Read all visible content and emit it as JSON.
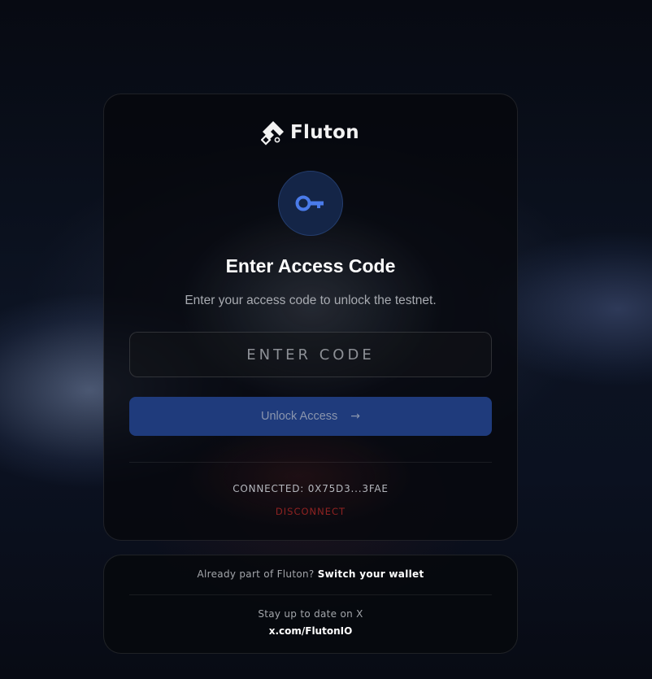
{
  "brand": {
    "name": "Fluton",
    "logo_icon": "fluton-logo-icon"
  },
  "access": {
    "icon": "key-icon",
    "title": "Enter Access Code",
    "subtitle": "Enter your access code to unlock the testnet.",
    "code_placeholder": "ENTER CODE",
    "code_value": "",
    "unlock_label": "Unlock Access",
    "unlock_icon": "arrow-right-icon"
  },
  "wallet": {
    "connected_text": "CONNECTED: 0X75D3...3FAE",
    "disconnect_label": "DISCONNECT"
  },
  "footer": {
    "already_text": "Already part of Fluton?",
    "switch_label": "Switch your wallet",
    "stay_text": "Stay up to date on X",
    "x_link": "x.com/FlutonIO"
  },
  "colors": {
    "accent": "#4a7bea",
    "button_bg": "#1f3b7c",
    "disconnect": "#8e2222",
    "card_bg": "#06080c"
  }
}
